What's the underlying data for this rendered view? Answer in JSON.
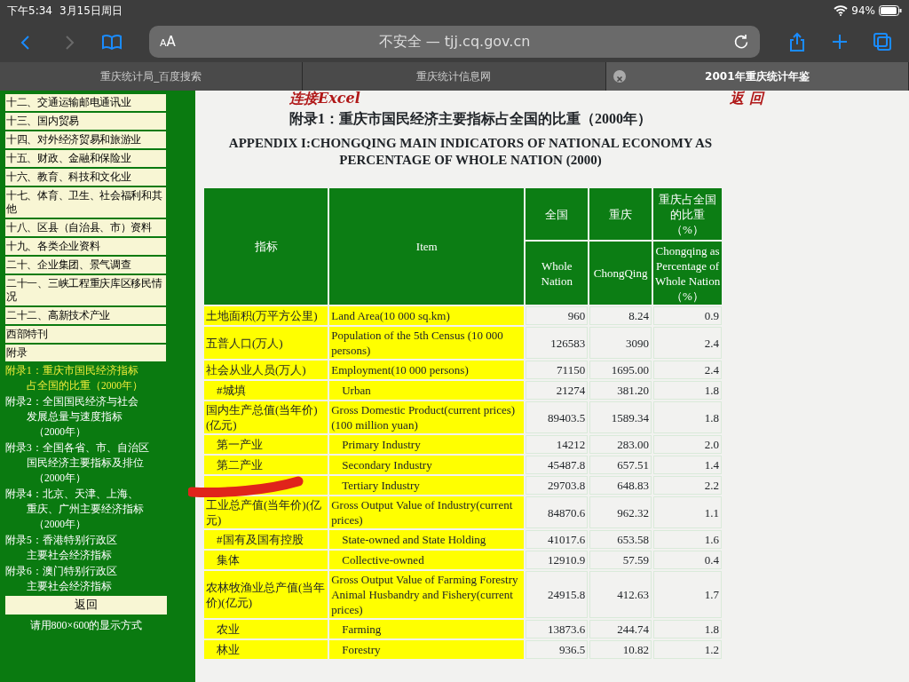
{
  "status_bar": {
    "time": "下午5:34",
    "date": "3月15日周日",
    "battery_text": "94%"
  },
  "toolbar": {
    "buttons": [
      {
        "kind": "back",
        "disabled": false
      },
      {
        "kind": "forward",
        "disabled": true
      },
      {
        "kind": "bookmarks",
        "disabled": false
      }
    ],
    "text_size": "AA",
    "url": "不安全 — tjj.cq.gov.cn",
    "right_buttons": [
      {
        "kind": "share"
      },
      {
        "kind": "new-tab"
      },
      {
        "kind": "tabs"
      }
    ]
  },
  "tabs": [
    {
      "label": "重庆统计局_百度搜索",
      "selected": false
    },
    {
      "label": "重庆统计信息网",
      "selected": false
    },
    {
      "label": "2001年重庆统计年鉴",
      "selected": true
    }
  ],
  "sidebar": {
    "chapters": [
      "十二、交通运输邮电通讯业",
      "十三、国内贸易",
      "十四、对外经济贸易和旅游业",
      "十五、财政、金融和保险业",
      "十六、教育、科技和文化业",
      "十七、体育、卫生、社会福利和其他",
      "十八、区县（自治县、市）资料",
      "十九、各类企业资料",
      "二十、企业集团、景气调查",
      "二十一、三峡工程重庆库区移民情况",
      "二十二、高新技术产业",
      "西部特刊",
      "附录"
    ],
    "appendices": [
      {
        "lines": [
          "附录1：重庆市国民经济指标",
          "占全国的比重（2000年）"
        ],
        "selected": true
      },
      {
        "lines": [
          "附录2：全国国民经济与社会",
          "发展总量与速度指标",
          "（2000年）"
        ],
        "selected": false
      },
      {
        "lines": [
          "附录3：全国各省、市、自治区",
          "国民经济主要指标及排位",
          "（2000年）"
        ],
        "selected": false
      },
      {
        "lines": [
          "附录4：北京、天津、上海、",
          "重庆、广州主要经济指标",
          "（2000年）"
        ],
        "selected": false
      },
      {
        "lines": [
          "附录5：香港特别行政区",
          "主要社会经济指标"
        ],
        "selected": false
      },
      {
        "lines": [
          "附录6：澳门特别行政区",
          "主要社会经济指标"
        ],
        "selected": false
      }
    ],
    "back_button": "返回",
    "note": "请用800×600的显示方式"
  },
  "page": {
    "excel_link": "连接Excel",
    "return_link": "返 回",
    "title_zh": "附录1：重庆市国民经济主要指标占全国的比重（2000年）",
    "title_en": "APPENDIX I:CHONGQING MAIN INDICATORS OF NATIONAL ECONOMY AS PERCENTAGE OF WHOLE NATION (2000)"
  },
  "table": {
    "columns": [
      {
        "zh": "指标"
      },
      {
        "zh": "Item"
      },
      {
        "zh": "全国",
        "en": "Whole Nation"
      },
      {
        "zh": "重庆",
        "en": "ChongQing"
      },
      {
        "zh": "重庆占全国的比重（%）",
        "en": "Chongqing as Percentage of Whole Nation（%）"
      }
    ],
    "rows": [
      {
        "zh": "土地面积(万平方公里)",
        "en": "Land Area(10 000 sq.km)",
        "nation": "960",
        "cq": "8.24",
        "pct": "0.9"
      },
      {
        "zh": "五普人口(万人)",
        "en": "Population of the 5th Census (10 000 persons)",
        "nation": "126583",
        "cq": "3090",
        "pct": "2.4"
      },
      {
        "zh": "社会从业人员(万人)",
        "en": "Employment(10 000 persons)",
        "nation": "71150",
        "cq": "1695.00",
        "pct": "2.4",
        "children": [
          {
            "zh": "#城填",
            "en": "Urban",
            "nation": "21274",
            "cq": "381.20",
            "pct": "1.8"
          }
        ]
      },
      {
        "zh": "国内生产总值(当年价)(亿元)",
        "en": "Gross Domestic Product(current prices)(100 million yuan)",
        "nation": "89403.5",
        "cq": "1589.34",
        "pct": "1.8",
        "children": [
          {
            "zh": "第一产业",
            "en": "Primary Industry",
            "nation": "14212",
            "cq": "283.00",
            "pct": "2.0"
          },
          {
            "zh": "第二产业",
            "en": "Secondary Industry",
            "nation": "45487.8",
            "cq": "657.51",
            "pct": "1.4"
          },
          {
            "en": "Tertiary Industry",
            "nation": "29703.8",
            "cq": "648.83",
            "pct": "2.2"
          }
        ]
      },
      {
        "zh": "工业总产值(当年价)(亿元)",
        "en": "Gross Output Value of Industry(current prices)",
        "nation": "84870.6",
        "cq": "962.32",
        "pct": "1.1",
        "children": [
          {
            "zh": "#国有及国有控股",
            "en": "State-owned and State Holding",
            "nation": "41017.6",
            "cq": "653.58",
            "pct": "1.6"
          },
          {
            "zh": "集体",
            "en": "Collective-owned",
            "nation": "12910.9",
            "cq": "57.59",
            "pct": "0.4"
          }
        ]
      },
      {
        "zh": "农林牧渔业总产值(当年价)(亿元)",
        "en": "Gross Output Value of Farming Forestry Animal Husbandry and Fishery(current prices)",
        "nation": "24915.8",
        "cq": "412.63",
        "pct": "1.7",
        "children": [
          {
            "zh": "农业",
            "en": "Farming",
            "nation": "13873.6",
            "cq": "244.74",
            "pct": "1.8"
          },
          {
            "zh": "林业",
            "en": "Forestry",
            "nation": "936.5",
            "cq": "10.82",
            "pct": "1.2"
          }
        ]
      }
    ]
  }
}
